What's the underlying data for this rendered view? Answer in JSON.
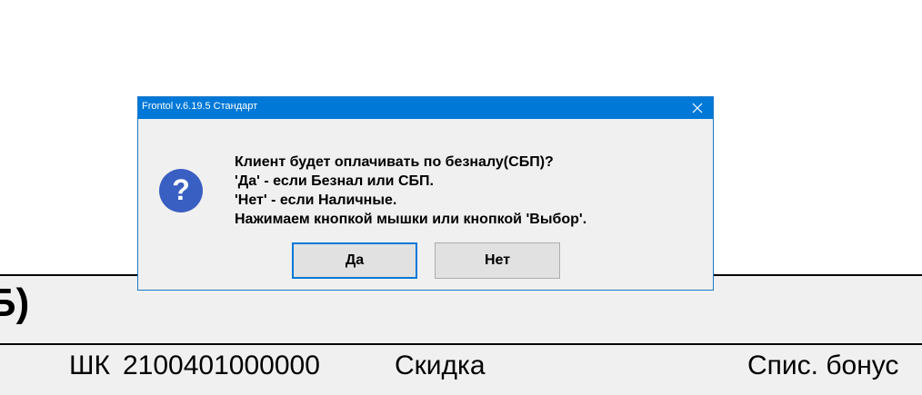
{
  "background": {
    "big_text": "Б)",
    "barcode_label": "ШК",
    "barcode_value": "2100401000000",
    "discount_label": "Скидка",
    "bonus_label": "Спис. бонус"
  },
  "dialog": {
    "title": "Frontol v.6.19.5 Стандарт",
    "icon": "question-icon",
    "message_lines": [
      "Клиент будет оплачивать по безналу(СБП)?",
      "'Да' - если Безнал или СБП.",
      "'Нет' - если Наличные.",
      "Нажимаем кнопкой мышки или кнопкой 'Выбор'."
    ],
    "yes_label": "Да",
    "no_label": "Нет"
  },
  "colors": {
    "titlebar": "#0078d7",
    "icon": "#3a5fc2"
  }
}
